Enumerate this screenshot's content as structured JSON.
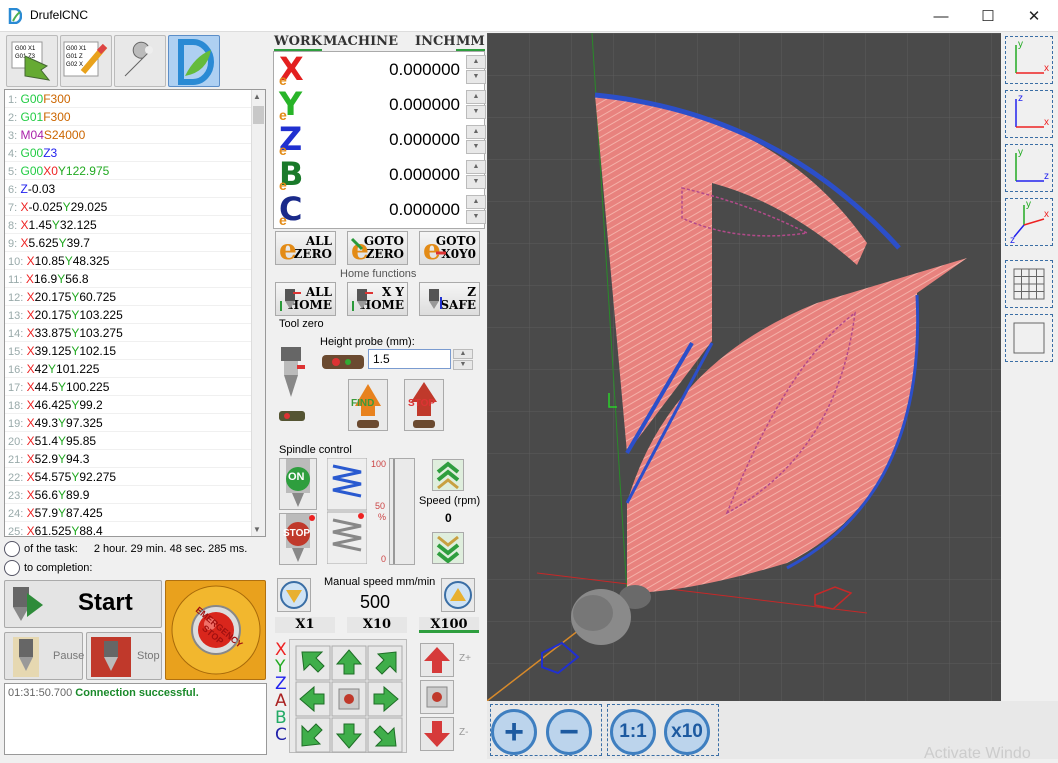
{
  "app": {
    "title": "DrufelCNC",
    "minimize": "—",
    "maximize": "☐",
    "close": "✕"
  },
  "code_lines": [
    {
      "n": "1:",
      "t": [
        [
          "gc",
          "G00"
        ],
        [
          "gf",
          "F300"
        ]
      ]
    },
    {
      "n": "2:",
      "t": [
        [
          "gc",
          "G01"
        ],
        [
          "gf",
          "F300"
        ]
      ]
    },
    {
      "n": "3:",
      "t": [
        [
          "gm",
          "M04"
        ],
        [
          "gs",
          "S24000"
        ]
      ]
    },
    {
      "n": "4:",
      "t": [
        [
          "gc",
          "G00"
        ],
        [
          "gz",
          "Z3"
        ]
      ]
    },
    {
      "n": "5:",
      "t": [
        [
          "gc",
          "G00"
        ],
        [
          "gx",
          "X0"
        ],
        [
          "gy",
          "Y122.975"
        ]
      ]
    },
    {
      "n": "6:",
      "t": [
        [
          "gz",
          "Z"
        ],
        [
          "",
          "-0.03"
        ]
      ]
    },
    {
      "n": "7:",
      "t": [
        [
          "gx",
          "X"
        ],
        [
          "",
          "-0.025"
        ],
        [
          "gy",
          "Y"
        ],
        [
          "",
          "29.025"
        ]
      ]
    },
    {
      "n": "8:",
      "t": [
        [
          "gx",
          "X"
        ],
        [
          "",
          "1.45"
        ],
        [
          "gy",
          "Y"
        ],
        [
          "",
          "32.125"
        ]
      ]
    },
    {
      "n": "9:",
      "t": [
        [
          "gx",
          "X"
        ],
        [
          "",
          "5.625"
        ],
        [
          "gy",
          "Y"
        ],
        [
          "",
          "39.7"
        ]
      ]
    },
    {
      "n": "10:",
      "t": [
        [
          "gx",
          "X"
        ],
        [
          "",
          "10.85"
        ],
        [
          "gy",
          "Y"
        ],
        [
          "",
          "48.325"
        ]
      ]
    },
    {
      "n": "11:",
      "t": [
        [
          "gx",
          "X"
        ],
        [
          "",
          "16.9"
        ],
        [
          "gy",
          "Y"
        ],
        [
          "",
          "56.8"
        ]
      ]
    },
    {
      "n": "12:",
      "t": [
        [
          "gx",
          "X"
        ],
        [
          "",
          "20.175"
        ],
        [
          "gy",
          "Y"
        ],
        [
          "",
          "60.725"
        ]
      ]
    },
    {
      "n": "13:",
      "t": [
        [
          "gx",
          "X"
        ],
        [
          "",
          "20.175"
        ],
        [
          "gy",
          "Y"
        ],
        [
          "",
          "103.225"
        ]
      ]
    },
    {
      "n": "14:",
      "t": [
        [
          "gx",
          "X"
        ],
        [
          "",
          "33.875"
        ],
        [
          "gy",
          "Y"
        ],
        [
          "",
          "103.275"
        ]
      ]
    },
    {
      "n": "15:",
      "t": [
        [
          "gx",
          "X"
        ],
        [
          "",
          "39.125"
        ],
        [
          "gy",
          "Y"
        ],
        [
          "",
          "102.15"
        ]
      ]
    },
    {
      "n": "16:",
      "t": [
        [
          "gx",
          "X"
        ],
        [
          "",
          "42"
        ],
        [
          "gy",
          "Y"
        ],
        [
          "",
          "101.225"
        ]
      ]
    },
    {
      "n": "17:",
      "t": [
        [
          "gx",
          "X"
        ],
        [
          "",
          "44.5"
        ],
        [
          "gy",
          "Y"
        ],
        [
          "",
          "100.225"
        ]
      ]
    },
    {
      "n": "18:",
      "t": [
        [
          "gx",
          "X"
        ],
        [
          "",
          "46.425"
        ],
        [
          "gy",
          "Y"
        ],
        [
          "",
          "99.2"
        ]
      ]
    },
    {
      "n": "19:",
      "t": [
        [
          "gx",
          "X"
        ],
        [
          "",
          "49.3"
        ],
        [
          "gy",
          "Y"
        ],
        [
          "",
          "97.325"
        ]
      ]
    },
    {
      "n": "20:",
      "t": [
        [
          "gx",
          "X"
        ],
        [
          "",
          "51.4"
        ],
        [
          "gy",
          "Y"
        ],
        [
          "",
          "95.85"
        ]
      ]
    },
    {
      "n": "21:",
      "t": [
        [
          "gx",
          "X"
        ],
        [
          "",
          "52.9"
        ],
        [
          "gy",
          "Y"
        ],
        [
          "",
          "94.3"
        ]
      ]
    },
    {
      "n": "22:",
      "t": [
        [
          "gx",
          "X"
        ],
        [
          "",
          "54.575"
        ],
        [
          "gy",
          "Y"
        ],
        [
          "",
          "92.275"
        ]
      ]
    },
    {
      "n": "23:",
      "t": [
        [
          "gx",
          "X"
        ],
        [
          "",
          "56.6"
        ],
        [
          "gy",
          "Y"
        ],
        [
          "",
          "89.9"
        ]
      ]
    },
    {
      "n": "24:",
      "t": [
        [
          "gx",
          "X"
        ],
        [
          "",
          "57.9"
        ],
        [
          "gy",
          "Y"
        ],
        [
          "",
          "87.425"
        ]
      ]
    },
    {
      "n": "25:",
      "t": [
        [
          "gx",
          "X"
        ],
        [
          "",
          "61.525"
        ],
        [
          "gy",
          "Y"
        ],
        [
          "",
          "88.4"
        ]
      ]
    }
  ],
  "time": {
    "task_label": "of the task:",
    "task_value": "2 hour. 29 min. 48 sec. 285 ms.",
    "completion_label": "to completion:"
  },
  "controls": {
    "start": "Start",
    "pause": "Pause",
    "stop": "Stop",
    "emergency": "EMERGENCY STOP"
  },
  "log": {
    "time": "01:31:50.700",
    "message": "Connection successful."
  },
  "coords": {
    "tabs": {
      "work": "WORK",
      "machine": "MACHINE",
      "inch": "INCH",
      "mm": "MM"
    },
    "axes": [
      {
        "letter": "X",
        "value": "0.000000",
        "color": "#e32020"
      },
      {
        "letter": "Y",
        "value": "0.000000",
        "color": "#28b428"
      },
      {
        "letter": "Z",
        "value": "0.000000",
        "color": "#2030d0"
      },
      {
        "letter": "B",
        "value": "0.000000",
        "color": "#1a7a2a"
      },
      {
        "letter": "C",
        "value": "0.000000",
        "color": "#1a2a8a"
      }
    ]
  },
  "zero": {
    "all": [
      "ALL",
      "ZERO"
    ],
    "goto": [
      "GOTO",
      "ZERO"
    ],
    "gotoxy": [
      "GOTO",
      "X0Y0"
    ]
  },
  "home": {
    "label": "Home functions",
    "all": [
      "ALL",
      "HOME"
    ],
    "xy": [
      "X Y",
      "HOME"
    ],
    "safe": [
      "Z",
      "SAFE"
    ]
  },
  "tool_zero": {
    "label": "Tool zero",
    "probe_label": "Height probe (mm):",
    "probe_value": "1.5",
    "find": "FIND",
    "stop": "STOP"
  },
  "spindle": {
    "label": "Spindle control",
    "on": "ON",
    "stop": "STOP",
    "scale": [
      "100",
      "50",
      "%",
      "0"
    ],
    "speed_label": "Speed (rpm)",
    "speed_value": "0"
  },
  "manual": {
    "label": "Manual speed mm/min",
    "value": "500",
    "x1": "X1",
    "x10": "X10",
    "x100": "X100"
  },
  "jog_axes": [
    "X",
    "Y",
    "Z",
    "A",
    "B",
    "C"
  ],
  "jog_z": {
    "plus": "Z+",
    "minus": "Z-"
  },
  "zoom": {
    "in": "+",
    "out": "−",
    "one": "1:1",
    "ten": "x10"
  },
  "watermark": "Activate Windo",
  "colors": {
    "toolpath": "#e87c7c",
    "edge": "#2c4fc9",
    "grid": "#5c5c5c",
    "bg": "#4a4a4a"
  }
}
